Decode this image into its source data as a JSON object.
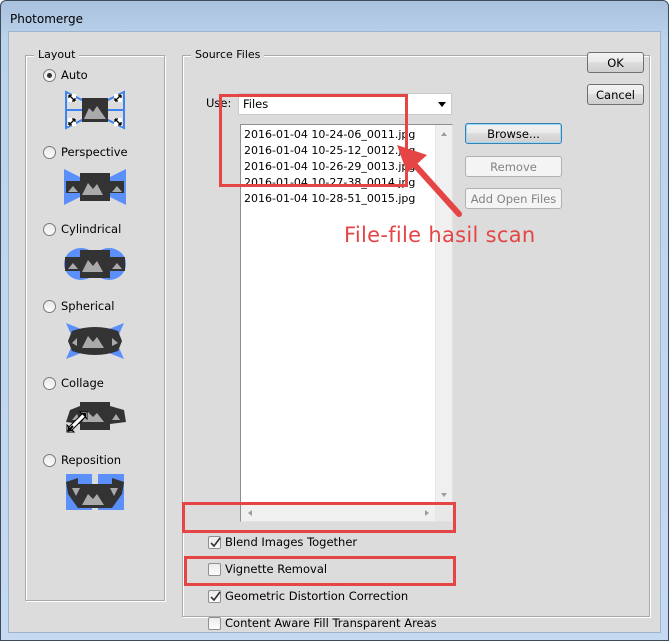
{
  "window": {
    "title": "Photomerge"
  },
  "layout": {
    "legend": "Layout",
    "options": [
      {
        "label": "Auto",
        "selected": true,
        "icon": "auto-layout-icon"
      },
      {
        "label": "Perspective",
        "selected": false,
        "icon": "perspective-layout-icon"
      },
      {
        "label": "Cylindrical",
        "selected": false,
        "icon": "cylindrical-layout-icon"
      },
      {
        "label": "Spherical",
        "selected": false,
        "icon": "spherical-layout-icon"
      },
      {
        "label": "Collage",
        "selected": false,
        "icon": "collage-layout-icon"
      },
      {
        "label": "Reposition",
        "selected": false,
        "icon": "reposition-layout-icon"
      }
    ]
  },
  "source": {
    "legend": "Source Files",
    "use_label": "Use:",
    "use_value": "Files",
    "files": [
      "2016-01-04 10-24-06_0011.jpg",
      "2016-01-04 10-25-12_0012.jpg",
      "2016-01-04 10-26-29_0013.jpg",
      "2016-01-04 10-27-38_0014.jpg",
      "2016-01-04 10-28-51_0015.jpg"
    ],
    "buttons": {
      "browse": "Browse...",
      "remove": "Remove",
      "add_open_files": "Add Open Files"
    },
    "options": [
      {
        "label": "Blend Images Together",
        "checked": true
      },
      {
        "label": "Vignette Removal",
        "checked": false
      },
      {
        "label": "Geometric Distortion Correction",
        "checked": true
      },
      {
        "label": "Content Aware Fill Transparent Areas",
        "checked": false
      }
    ]
  },
  "dialog_buttons": {
    "ok": "OK",
    "cancel": "Cancel"
  },
  "annotation": {
    "text": "File-file hasil scan",
    "color": "#e64545"
  },
  "colors": {
    "accent_blue": "#5b8ff9",
    "icon_dark": "#333333",
    "icon_gray": "#a0a0a0"
  }
}
